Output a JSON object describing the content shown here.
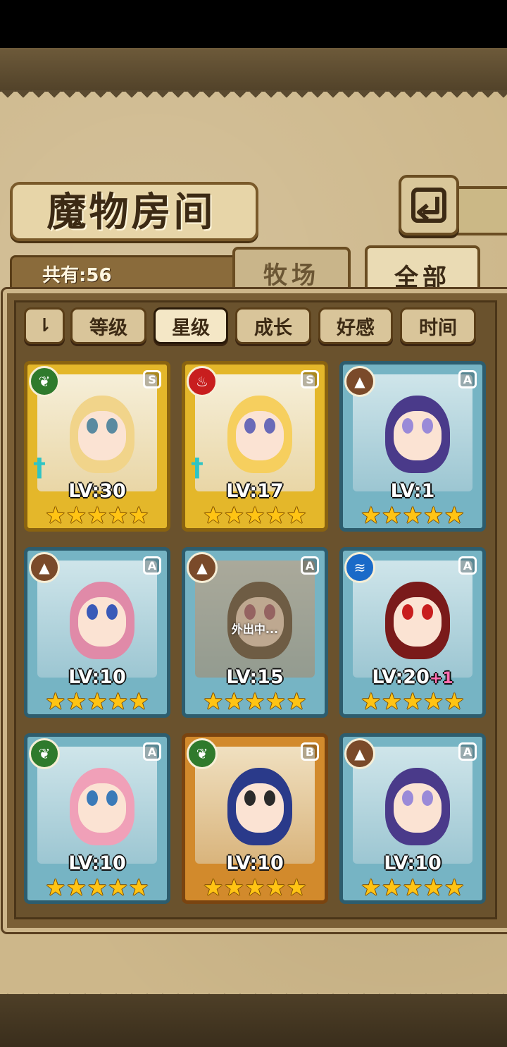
{
  "header": {
    "title": "魔物房间",
    "back_icon": "return-arrow-icon"
  },
  "summary": {
    "total_label": "共有:56"
  },
  "tabs": [
    {
      "label": "牧场",
      "active": false
    },
    {
      "label": "全部",
      "active": true
    }
  ],
  "sort": {
    "toggle_label": "⇂",
    "options": [
      {
        "label": "等级",
        "active": false
      },
      {
        "label": "星级",
        "active": true
      },
      {
        "label": "成长",
        "active": false
      },
      {
        "label": "好感",
        "active": false
      },
      {
        "label": "时间",
        "active": false
      }
    ]
  },
  "cards": [
    {
      "frame": "gold",
      "rank": "S",
      "element": "leaf",
      "level": "LV:30",
      "bonus": "",
      "stars": "★★★★★",
      "status": "",
      "weapon": true,
      "hair": "#f1d48a",
      "eye": "#5a8aa0"
    },
    {
      "frame": "gold",
      "rank": "S",
      "element": "fire",
      "level": "LV:17",
      "bonus": "",
      "stars": "★★★★★",
      "status": "",
      "weapon": true,
      "hair": "#f6cf5e",
      "eye": "#6a6ab8"
    },
    {
      "frame": "blue",
      "rank": "A",
      "element": "earth",
      "level": "LV:1",
      "bonus": "",
      "stars": "★★★★★",
      "status": "",
      "weapon": false,
      "hair": "#4a3a8a",
      "eye": "#9a8ad8"
    },
    {
      "frame": "blue",
      "rank": "A",
      "element": "earth",
      "level": "LV:10",
      "bonus": "",
      "stars": "★★★★★",
      "status": "",
      "weapon": false,
      "hair": "#e08aa8",
      "eye": "#3a5ab8"
    },
    {
      "frame": "blue",
      "rank": "A",
      "element": "earth",
      "level": "LV:15",
      "bonus": "",
      "stars": "★★★★★",
      "status": "外出中...",
      "weapon": false,
      "hair": "#4a3a2a",
      "eye": "#a04a6a"
    },
    {
      "frame": "blue",
      "rank": "A",
      "element": "water",
      "level": "LV:20",
      "bonus": "+1",
      "stars": "★★★★★",
      "status": "",
      "weapon": false,
      "hair": "#7a1a1a",
      "eye": "#c81e1e"
    },
    {
      "frame": "blue",
      "rank": "A",
      "element": "leaf",
      "level": "LV:10",
      "bonus": "",
      "stars": "★★★★★",
      "status": "",
      "weapon": false,
      "hair": "#f0a0b8",
      "eye": "#3a7ab8"
    },
    {
      "frame": "bronze",
      "rank": "B",
      "element": "leaf",
      "level": "LV:10",
      "bonus": "",
      "stars": "★★★★★",
      "status": "",
      "weapon": false,
      "hair": "#2a3a8a",
      "eye": "#2a2a2a"
    },
    {
      "frame": "blue",
      "rank": "A",
      "element": "earth",
      "level": "LV:10",
      "bonus": "",
      "stars": "★★★★★",
      "status": "",
      "weapon": false,
      "hair": "#4a3a8a",
      "eye": "#9a8ad8"
    }
  ]
}
